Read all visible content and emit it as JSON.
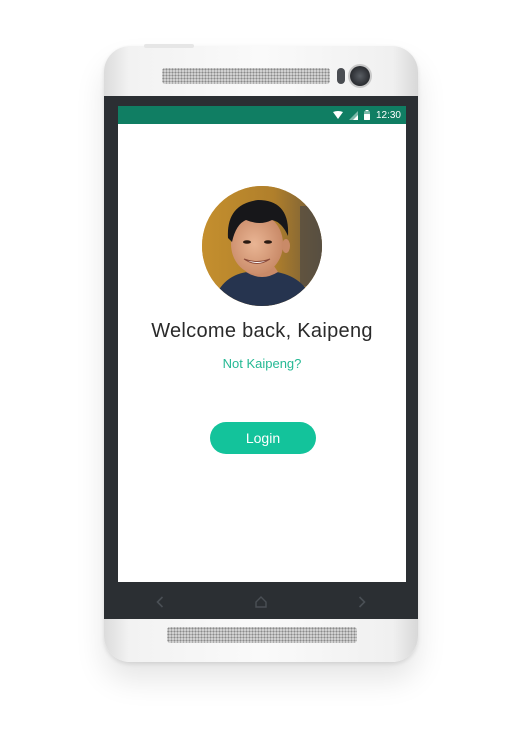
{
  "status_bar": {
    "time": "12:30",
    "icons": [
      "wifi-icon",
      "signal-icon",
      "battery-icon"
    ],
    "color": "#107e63"
  },
  "profile": {
    "welcome_text": "Welcome back, Kaipeng",
    "not_user_link": "Not Kaipeng?"
  },
  "actions": {
    "login_label": "Login",
    "accent_color": "#13c39b"
  },
  "nav_bar": {
    "buttons": [
      "back-icon",
      "home-icon",
      "forward-icon"
    ]
  }
}
